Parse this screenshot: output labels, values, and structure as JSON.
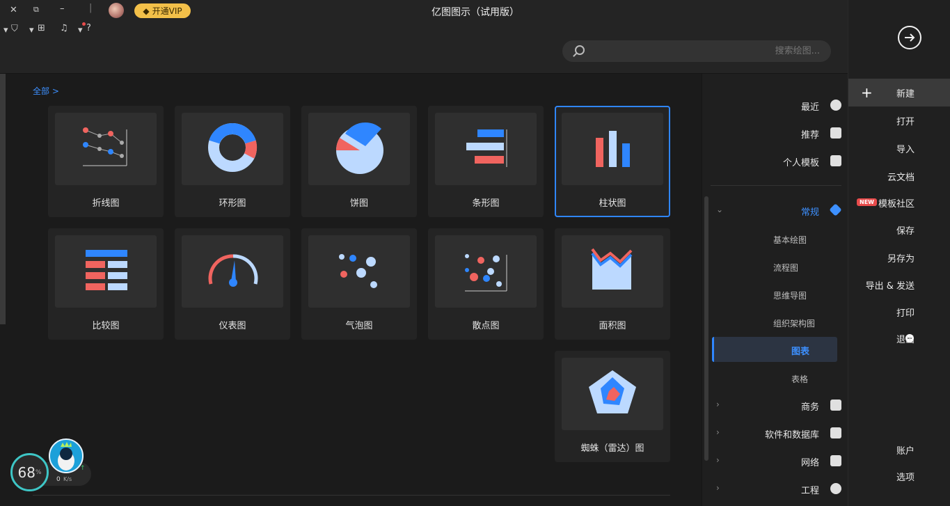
{
  "window": {
    "title": "亿图图示（试用版）",
    "vip_label": "开通VIP"
  },
  "toolbar": {
    "search_placeholder": "搜索绘图..."
  },
  "file_menu": {
    "items": [
      {
        "label": "新建"
      },
      {
        "label": "打开"
      },
      {
        "label": "导入"
      },
      {
        "label": "云文档"
      },
      {
        "label": "模板社区",
        "badge": "NEW"
      },
      {
        "label": "保存"
      },
      {
        "label": "另存为"
      },
      {
        "label": "导出 & 发送"
      },
      {
        "label": "打印"
      },
      {
        "label": "退出"
      }
    ],
    "bottom": [
      {
        "label": "账户"
      },
      {
        "label": "选项"
      }
    ]
  },
  "categories": {
    "top": [
      {
        "label": "最近",
        "icon": "clock-icon"
      },
      {
        "label": "推荐",
        "icon": "star-icon"
      },
      {
        "label": "个人模板",
        "icon": "template-icon"
      }
    ],
    "groups": [
      {
        "label": "常规",
        "icon": "tag-icon",
        "expanded": true
      },
      {
        "label": "商务",
        "icon": "briefcase-icon"
      },
      {
        "label": "软件和数据库",
        "icon": "code-icon"
      },
      {
        "label": "网络",
        "icon": "network-icon"
      },
      {
        "label": "工程",
        "icon": "helmet-icon"
      }
    ],
    "sub": [
      {
        "label": "基本绘图"
      },
      {
        "label": "流程图"
      },
      {
        "label": "思维导图"
      },
      {
        "label": "组织架构图"
      },
      {
        "label": "图表",
        "active": true
      },
      {
        "label": "表格"
      }
    ]
  },
  "breadcrumb": "全部 >",
  "gallery": [
    {
      "label": "柱状图",
      "selected": true
    },
    {
      "label": "条形图"
    },
    {
      "label": "饼图"
    },
    {
      "label": "环形图"
    },
    {
      "label": "折线图"
    },
    {
      "label": "面积图"
    },
    {
      "label": "散点图"
    },
    {
      "label": "气泡图"
    },
    {
      "label": "仪表图"
    },
    {
      "label": "比较图"
    },
    {
      "label": "蜘蛛（雷达）图"
    }
  ],
  "widget": {
    "percent": "68",
    "percent_unit": "%",
    "speed": "0",
    "speed_unit": "K/s"
  },
  "colors": {
    "accent": "#2f86ff",
    "red": "#f0645f",
    "light_blue": "#bcd9ff",
    "vip": "#f3c049"
  }
}
